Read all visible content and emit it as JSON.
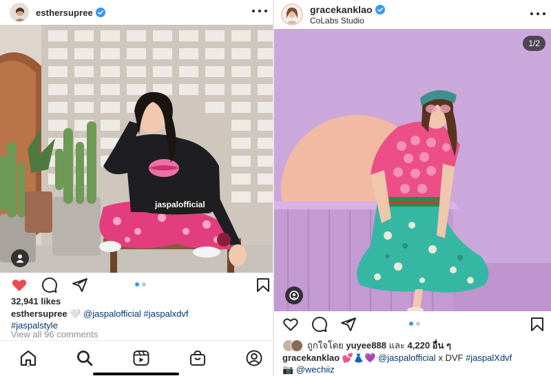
{
  "left_post": {
    "username": "esthersupree",
    "photo_tag": "jaspalofficial",
    "likes": "32,941 likes",
    "caption": {
      "username": "esthersupree",
      "emoji": "🤍",
      "line1_links": "@jaspalofficial #jaspalxdvf",
      "line2_links": "#jaspalstyle"
    },
    "view_comments": "View all 96 comments"
  },
  "right_post": {
    "username": "gracekanklao",
    "location": "CoLabs Studio",
    "counter": "1/2",
    "liked_by": {
      "prefix": "ถูกใจโดย",
      "user": "yuyee888",
      "conj": "และ",
      "count": "4,220 อื่น ๆ"
    },
    "caption": {
      "username": "gracekanklao",
      "emoji": "💕👗💜",
      "mention1": "@jaspalofficial",
      "x_text": "x DVF",
      "hashtag": "#jaspalXdvf",
      "line2_emoji": "📷",
      "mention2": "@wechiiz"
    }
  },
  "colors": {
    "like_red": "#ed4956",
    "verified_blue": "#3897f0",
    "link_blue": "#00376b",
    "dot_active": "#3897f0",
    "dot_inactive": "#c7c7c7"
  },
  "icons": {
    "left_actions": [
      "heart-filled-icon",
      "comment-icon",
      "share-icon",
      "bookmark-icon"
    ],
    "right_actions": [
      "heart-outline-icon",
      "comment-icon",
      "share-icon",
      "bookmark-icon"
    ],
    "bottom_nav": [
      "home-icon",
      "search-icon",
      "reels-icon",
      "shop-icon",
      "profile-icon"
    ]
  }
}
